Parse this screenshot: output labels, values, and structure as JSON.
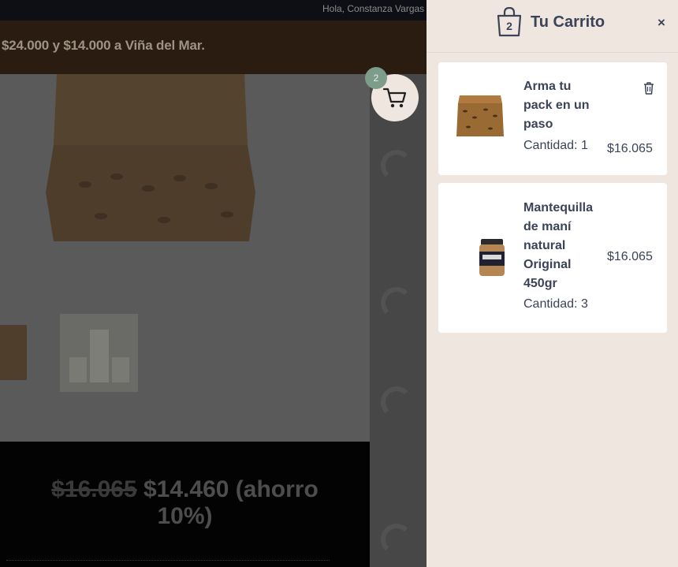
{
  "header": {
    "greeting": "Hola, Constanza Vargas"
  },
  "promo_banner": {
    "text": "$24.000 y $14.000 a Viña del Mar."
  },
  "product_page": {
    "old_price": "$16.065",
    "new_price": "$14.460 (ahorro",
    "new_price_cont": "10%)"
  },
  "cart_fab": {
    "count": "2"
  },
  "cart": {
    "title": "Tu Carrito",
    "bag_count": "2",
    "close_label": "×",
    "items": [
      {
        "name_lines": [
          "Arma tu",
          "pack en un",
          "paso"
        ],
        "quantity_label": "Cantidad: 1",
        "price": "$16.065"
      },
      {
        "name_lines": [
          "Mantequilla",
          "de maní",
          "natural",
          "Original",
          "450gr"
        ],
        "quantity_label": "Cantidad: 3",
        "price": "$16.065"
      }
    ]
  },
  "colors": {
    "accent_green": "#7d9c8a",
    "drawer_bg": "#f0e6e0",
    "text_dark": "#3b4358"
  }
}
